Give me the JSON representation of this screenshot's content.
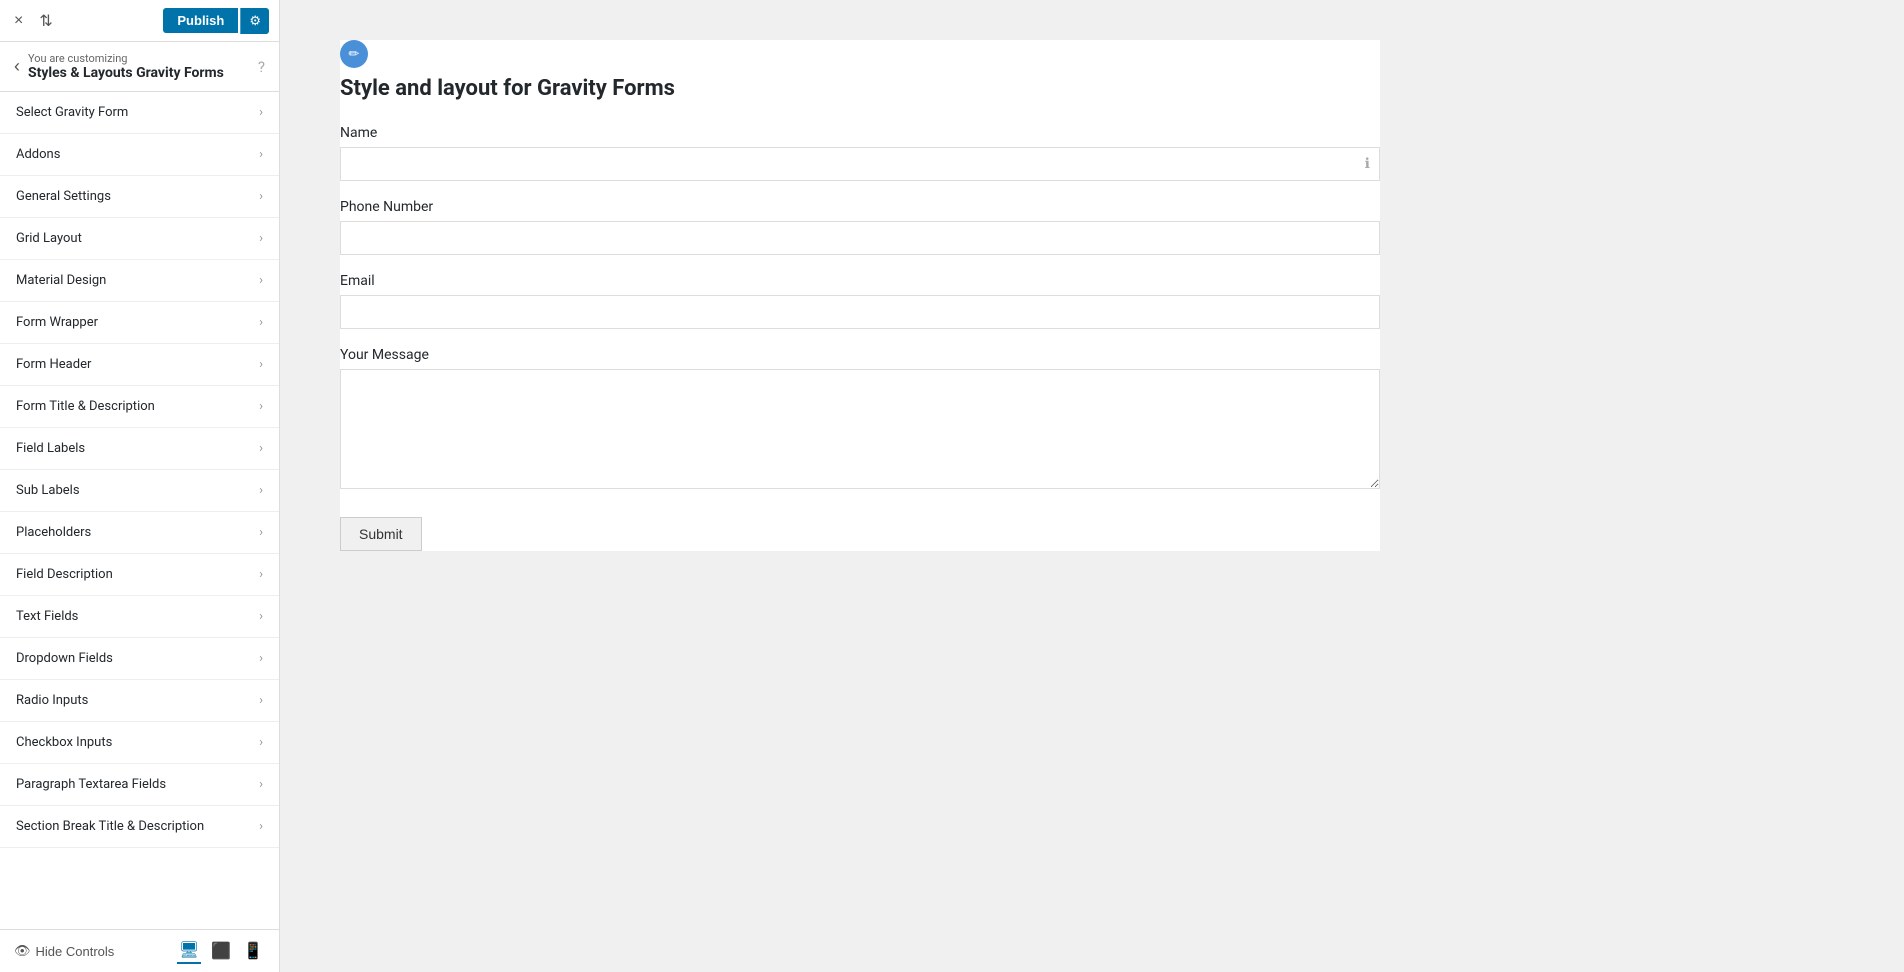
{
  "topbar": {
    "close_icon": "×",
    "sort_icon": "⇅",
    "publish_label": "Publish",
    "gear_icon": "⚙"
  },
  "header": {
    "back_icon": "‹",
    "you_are": "You are customizing",
    "title": "Styles & Layouts Gravity Forms",
    "help_icon": "?"
  },
  "nav": {
    "items": [
      {
        "label": "Select Gravity Form"
      },
      {
        "label": "Addons"
      },
      {
        "label": "General Settings"
      },
      {
        "label": "Grid Layout"
      },
      {
        "label": "Material Design"
      },
      {
        "label": "Form Wrapper"
      },
      {
        "label": "Form Header"
      },
      {
        "label": "Form Title & Description"
      },
      {
        "label": "Field Labels"
      },
      {
        "label": "Sub Labels"
      },
      {
        "label": "Placeholders"
      },
      {
        "label": "Field Description"
      },
      {
        "label": "Text Fields"
      },
      {
        "label": "Dropdown Fields"
      },
      {
        "label": "Radio Inputs"
      },
      {
        "label": "Checkbox Inputs"
      },
      {
        "label": "Paragraph Textarea Fields"
      },
      {
        "label": "Section Break Title & Description"
      }
    ],
    "chevron": "›"
  },
  "bottom": {
    "hide_controls_label": "Hide Controls",
    "monitor_icon": "🖥",
    "tablet_icon": "⬜",
    "mobile_icon": "📱"
  },
  "preview": {
    "edit_icon": "✏",
    "main_title": "Style and layout for Gravity Forms",
    "fields": [
      {
        "label": "Name",
        "type": "text",
        "has_icon": true
      },
      {
        "label": "Phone Number",
        "type": "text",
        "has_icon": false
      },
      {
        "label": "Email",
        "type": "text",
        "has_icon": false
      },
      {
        "label": "Your Message",
        "type": "textarea",
        "has_icon": false
      }
    ],
    "submit_label": "Submit"
  }
}
